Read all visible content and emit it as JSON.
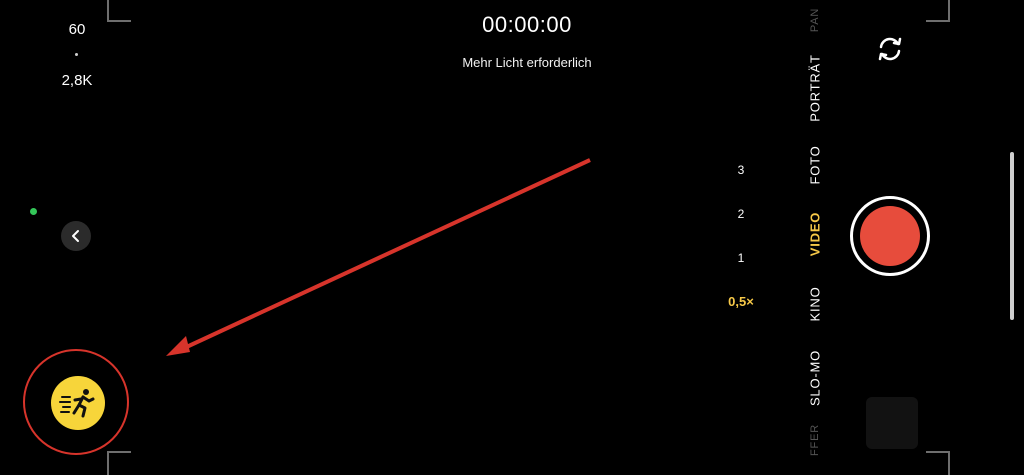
{
  "status": {
    "fps": "60",
    "resolution": "2,8K",
    "timer": "00:00:00",
    "hint": "Mehr Licht erforderlich"
  },
  "zoom": {
    "levels": [
      "3",
      "2",
      "1",
      "0,5×"
    ],
    "active_index": 3
  },
  "modes": {
    "items": [
      "PAN",
      "PORTRÄT",
      "FOTO",
      "VIDEO",
      "KINO",
      "SLO-MO",
      "ZEITRAFFER"
    ],
    "visible_partial": [
      "PAN",
      "FFER"
    ],
    "active": "VIDEO"
  },
  "colors": {
    "accent_yellow": "#f7c948",
    "action_button": "#f7d53a",
    "record_red": "#e74c3c",
    "annotation_red": "#d7342b"
  },
  "icons": {
    "back": "chevron-left-icon",
    "action_mode": "running-person-icon",
    "flip_camera": "camera-flip-icon"
  }
}
